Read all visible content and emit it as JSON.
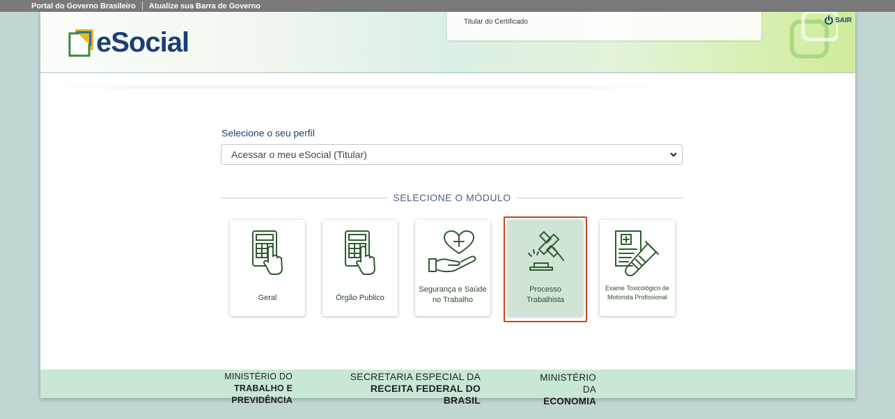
{
  "gov_bar": {
    "portal_link": "Portal do Governo Brasileiro",
    "update_link": "Atualize sua Barra de Governo"
  },
  "header": {
    "logo_text": "eSocial",
    "cert_label": "Titular do Certificado",
    "logout_label": "SAIR"
  },
  "profile": {
    "label": "Selecione o seu perfil",
    "selected": "Acessar o meu eSocial (Titular)"
  },
  "modules": {
    "title": "SELECIONE O MÓDULO",
    "items": [
      {
        "label": "Geral",
        "icon": "calculator-icon"
      },
      {
        "label": "Órgão Publico",
        "icon": "calculator-icon"
      },
      {
        "label": "Segurança e Saúde no Trabalho",
        "icon": "heart-hand-icon"
      },
      {
        "label": "Processo Trabalhista",
        "icon": "gavel-icon",
        "selected": true
      },
      {
        "label": "Exame Toxicológico de Motorista Profissional",
        "icon": "test-tube-icon"
      }
    ]
  },
  "footer": {
    "ministry1_line1": "MINISTÉRIO DO",
    "ministry1_line2": "TRABALHO E PREVIDÊNCIA",
    "secretaria_line1": "SECRETARIA ESPECIAL DA",
    "secretaria_line2": "RECEITA FEDERAL DO BRASIL",
    "ministry2_line1": "MINISTÉRIO DA",
    "ministry2_line2": "ECONOMIA"
  },
  "colors": {
    "accent_blue": "#1c3f73",
    "icon_green": "#2f5a2f",
    "selected_border": "#c3471a",
    "selected_bg": "#d0e4d6",
    "footer_bg": "#c8e8d4"
  }
}
